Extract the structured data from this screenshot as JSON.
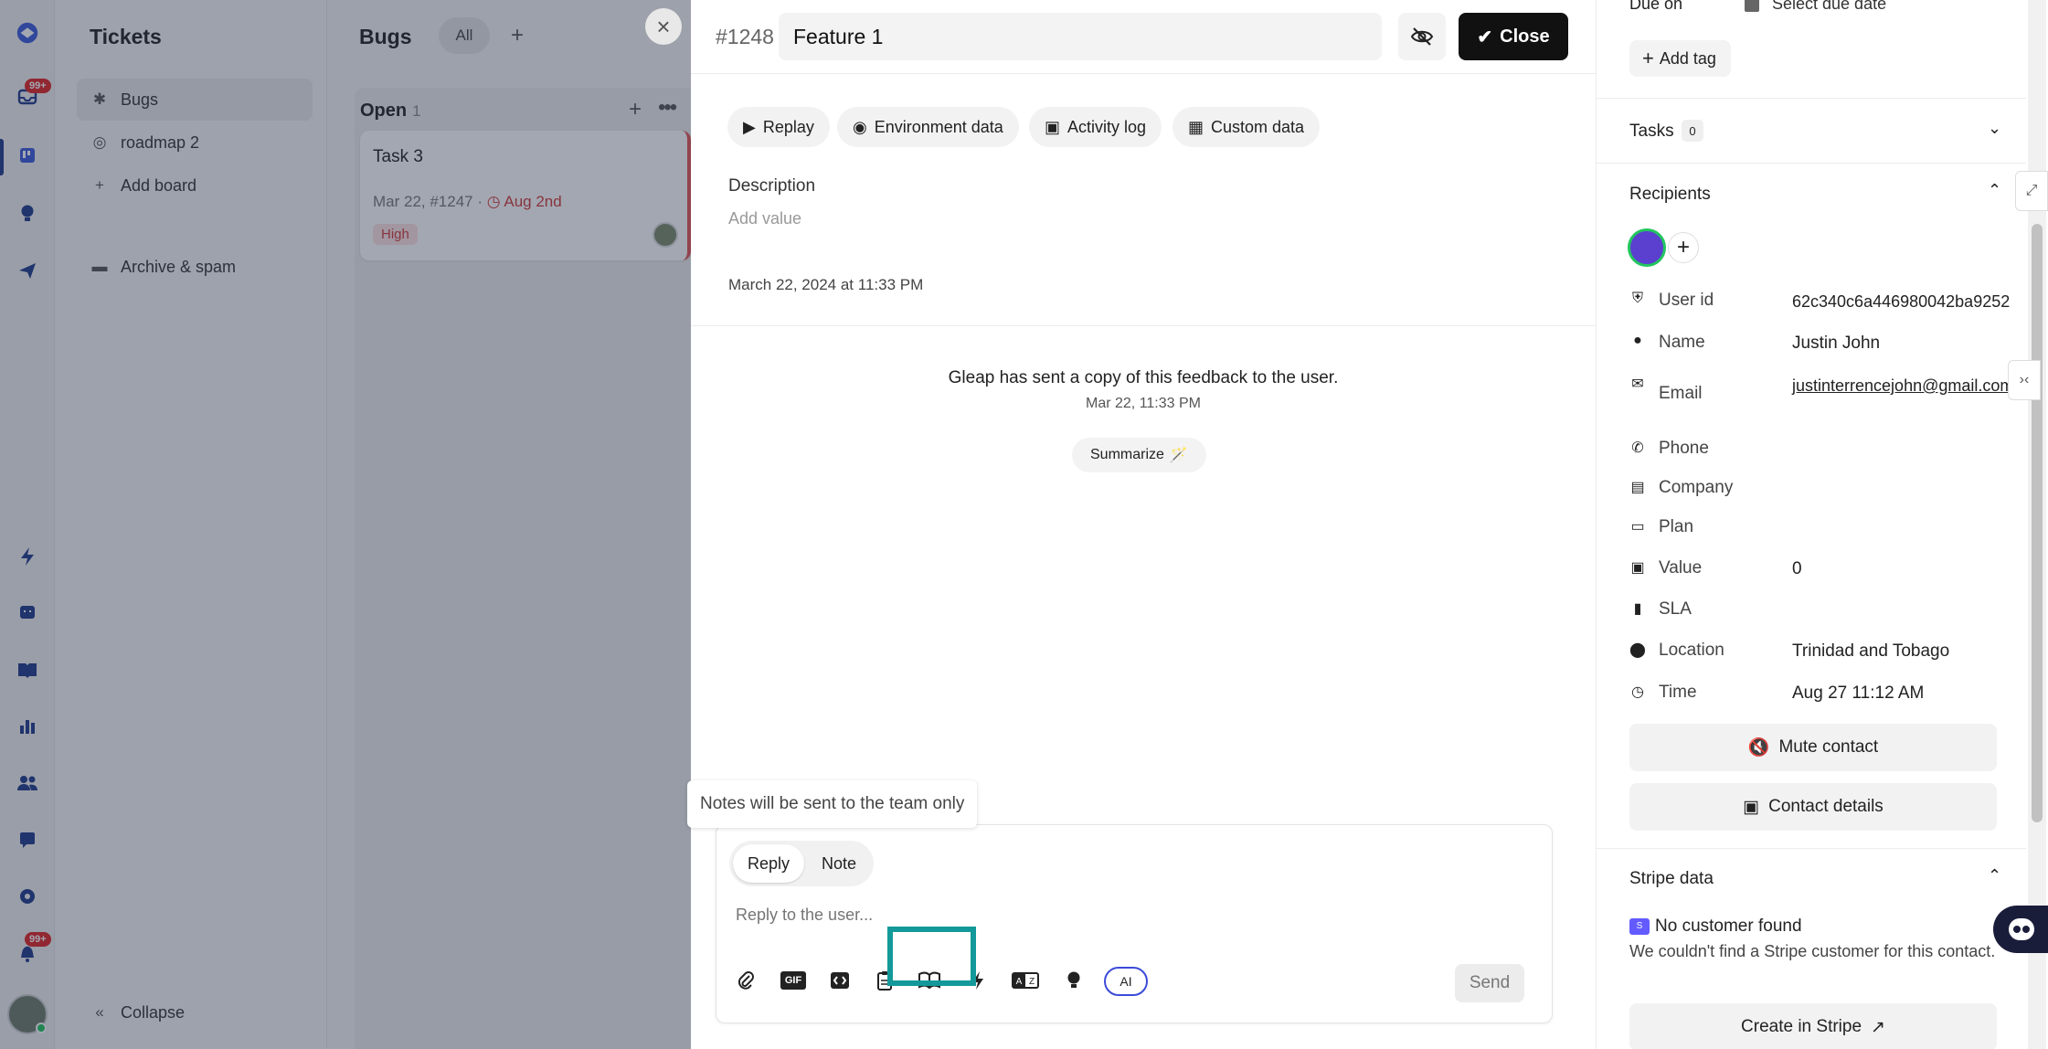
{
  "rail": {
    "badge_inbox": "99+",
    "badge_notifications": "99+"
  },
  "sidebar": {
    "title": "Tickets",
    "items": [
      {
        "label": "Bugs",
        "icon": "bug-icon"
      },
      {
        "label": "roadmap 2",
        "icon": "target-icon"
      },
      {
        "label": "Add board",
        "icon": "plus-icon"
      },
      {
        "label": "Archive & spam",
        "icon": "archive-icon"
      }
    ],
    "collapse_label": "Collapse"
  },
  "board": {
    "title": "Bugs",
    "filter_all": "All",
    "add": "+",
    "column": {
      "title": "Open",
      "count": "1"
    },
    "card": {
      "title": "Task 3",
      "meta": "Mar 22, #1247 ·",
      "due": "Aug 2nd",
      "priority": "High"
    }
  },
  "detail": {
    "ticket_id": "#1248",
    "title_value": "Feature 1",
    "close_label": "Close",
    "tabs": [
      "Replay",
      "Environment data",
      "Activity log",
      "Custom data"
    ],
    "description_label": "Description",
    "description_placeholder": "Add value",
    "created_date": "March 22, 2024 at 11:33 PM",
    "system_message": "Gleap has sent a copy of this feedback to the user.",
    "system_time": "Mar 22, 11:33 PM",
    "summarize_label": "Summarize",
    "tooltip": "Notes will be sent to the team only",
    "composer": {
      "reply_tab": "Reply",
      "note_tab": "Note",
      "placeholder": "Reply to the user...",
      "gif_label": "GIF",
      "ai_label": "AI",
      "send_label": "Send"
    }
  },
  "info": {
    "due_label": "Due on",
    "due_value": "Select due date",
    "add_tag": "Add tag",
    "tasks_label": "Tasks",
    "tasks_count": "0",
    "recipients_label": "Recipients",
    "fields": [
      {
        "label": "User id",
        "value": "62c340c6a446980042ba9252",
        "icon": "shield-check-icon"
      },
      {
        "label": "Name",
        "value": "Justin John",
        "icon": "person-icon"
      },
      {
        "label": "Email",
        "value": "justinterrencejohn@gmail.com",
        "icon": "mail-icon"
      },
      {
        "label": "Phone",
        "value": "",
        "icon": "phone-icon"
      },
      {
        "label": "Company",
        "value": "",
        "icon": "building-icon"
      },
      {
        "label": "Plan",
        "value": "",
        "icon": "credit-card-icon"
      },
      {
        "label": "Value",
        "value": "0",
        "icon": "money-icon"
      },
      {
        "label": "SLA",
        "value": "",
        "icon": "file-icon"
      },
      {
        "label": "Location",
        "value": "Trinidad and Tobago",
        "icon": "pin-icon"
      },
      {
        "label": "Time",
        "value": "Aug 27 11:12 AM",
        "icon": "clock-icon"
      }
    ],
    "mute_label": "Mute contact",
    "contact_details_label": "Contact details",
    "stripe_label": "Stripe data",
    "stripe_none": "No customer found",
    "stripe_desc": "We couldn't find a Stripe customer for this contact.",
    "create_stripe": "Create in Stripe"
  },
  "colors": {
    "accent": "#1e3a8a",
    "badge": "#e02424",
    "highlight": "#14999a",
    "danger": "#d03b3b"
  }
}
